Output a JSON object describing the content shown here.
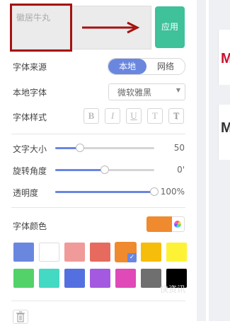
{
  "preview": {
    "text": "徽居牛丸"
  },
  "apply_button": {
    "label": "应用"
  },
  "font_source": {
    "label": "字体来源",
    "options": [
      "本地",
      "网络"
    ],
    "selected": "本地"
  },
  "local_font": {
    "label": "本地字体",
    "value": "微软雅黑"
  },
  "font_style": {
    "label": "字体样式",
    "buttons": [
      "B",
      "I",
      "U",
      "T",
      "T"
    ]
  },
  "sliders": [
    {
      "label": "文字大小",
      "value_text": "50",
      "value": 50,
      "fill_fraction": 0.25
    },
    {
      "label": "旋转角度",
      "value_text": "0'",
      "value": 0,
      "fill_fraction": 0.5
    },
    {
      "label": "透明度",
      "value_text": "100%",
      "value": 100,
      "fill_fraction": 1.0
    }
  ],
  "font_color": {
    "label": "字体颜色",
    "current": "#ef8a2e"
  },
  "swatches": [
    [
      "#6a87e0",
      "#ffffff",
      "#f09a9a",
      "#e66b5e",
      "#ef8a2e",
      "#f7bd0b",
      "#fef236"
    ],
    [
      "#53d26a",
      "#43d9c2",
      "#5470e0",
      "#a45ae0",
      "#e04ab8",
      "#6f6f6f",
      "#000000"
    ]
  ],
  "selected_swatch": "#ef8a2e",
  "watermark": "快资讯",
  "accent": "#6a87e0",
  "apply_color": "#3fc19a",
  "highlight_color": "#a51212"
}
